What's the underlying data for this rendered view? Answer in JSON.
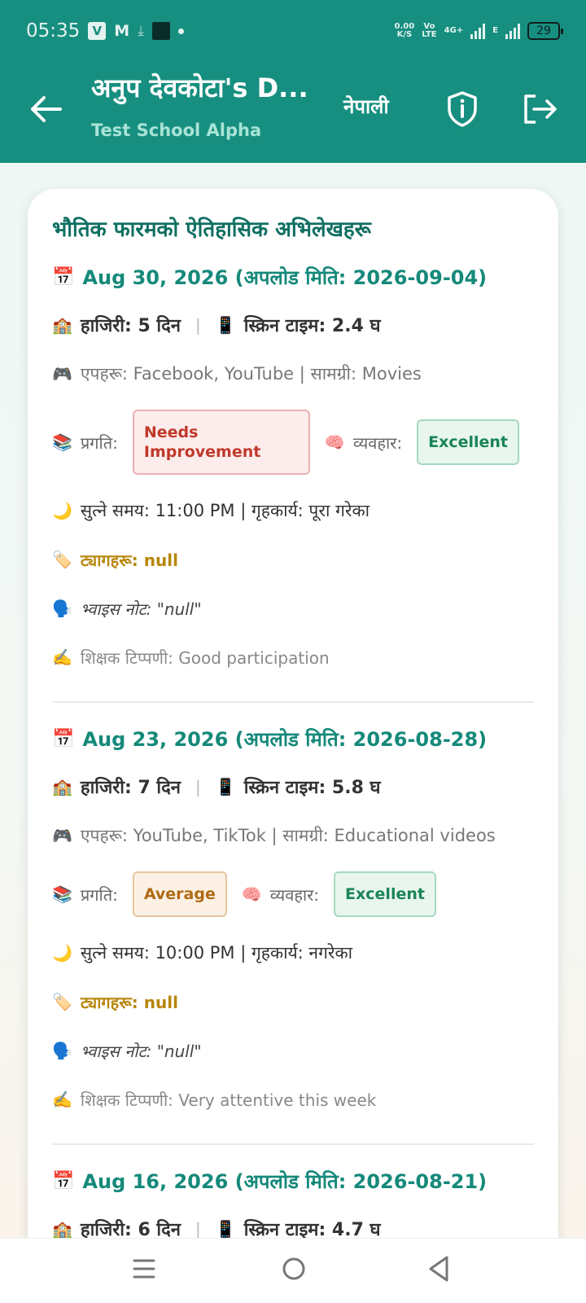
{
  "status_bar": {
    "time": "05:35",
    "net_speed_top": "0.00",
    "net_speed_bottom": "K/S",
    "volte_top": "Vo",
    "volte_bottom": "LTE",
    "network_4g": "4G+",
    "network_e": "E",
    "battery": "29"
  },
  "header": {
    "title": "अनुप देवकोटा's D...",
    "subtitle": "Test School Alpha",
    "language_button": "नेपाली",
    "back_icon": "arrow-left-icon",
    "privacy_icon": "shield-info-icon",
    "logout_icon": "logout-icon"
  },
  "card": {
    "title": "भौतिक फारमको ऐतिहासिक अभिलेखहरू"
  },
  "records": [
    {
      "date_line": "Aug 30, 2026 (अपलोड मिति: 2026-09-04)",
      "attendance": "हाजिरी: 5 दिन",
      "screen_time": "स्क्रिन टाइम: 2.4 घ",
      "apps_line": "एपहरू: Facebook, YouTube | सामग्री: Movies",
      "progress_label": "प्रगति:",
      "progress_value": "Needs Improvement",
      "progress_color": "#c0392b",
      "behavior_label": "व्यवहार:",
      "behavior_value": "Excellent",
      "behavior_color": "#1a8456",
      "sleep_line": "सुत्ने समय: 11:00 PM | गृहकार्य: पूरा गरेका",
      "tags_line": "ट्यागहरू: null",
      "voice_line": "भ्वाइस नोट: \"null\"",
      "teacher_line": "शिक्षक टिप्पणी: Good participation"
    },
    {
      "date_line": "Aug 23, 2026 (अपलोड मिति: 2026-08-28)",
      "attendance": "हाजिरी: 7 दिन",
      "screen_time": "स्क्रिन टाइम: 5.8 घ",
      "apps_line": "एपहरू: YouTube, TikTok | सामग्री: Educational videos",
      "progress_label": "प्रगति:",
      "progress_value": "Average",
      "progress_color": "#b06a14",
      "behavior_label": "व्यवहार:",
      "behavior_value": "Excellent",
      "behavior_color": "#1a8456",
      "sleep_line": "सुत्ने समय: 10:00 PM | गृहकार्य: नगरेका",
      "tags_line": "ट्यागहरू: null",
      "voice_line": "भ्वाइस नोट: \"null\"",
      "teacher_line": "शिक्षक टिप्पणी: Very attentive this week"
    },
    {
      "date_line": "Aug 16, 2026 (अपलोड मिति: 2026-08-21)",
      "attendance": "हाजिरी: 6 दिन",
      "screen_time": "स्क्रिन टाइम: 4.7 घ"
    }
  ],
  "icons": {
    "calendar": "📅",
    "school": "🏫",
    "phone": "📱",
    "gamepad": "🎮",
    "books": "📚",
    "brain": "🧠",
    "moon": "🌙",
    "tag": "🏷️",
    "voice": "🗣️",
    "writing": "✍️"
  },
  "nav": {
    "menu_icon": "menu-icon",
    "home_icon": "home-circle-icon",
    "back_icon": "back-triangle-icon"
  }
}
